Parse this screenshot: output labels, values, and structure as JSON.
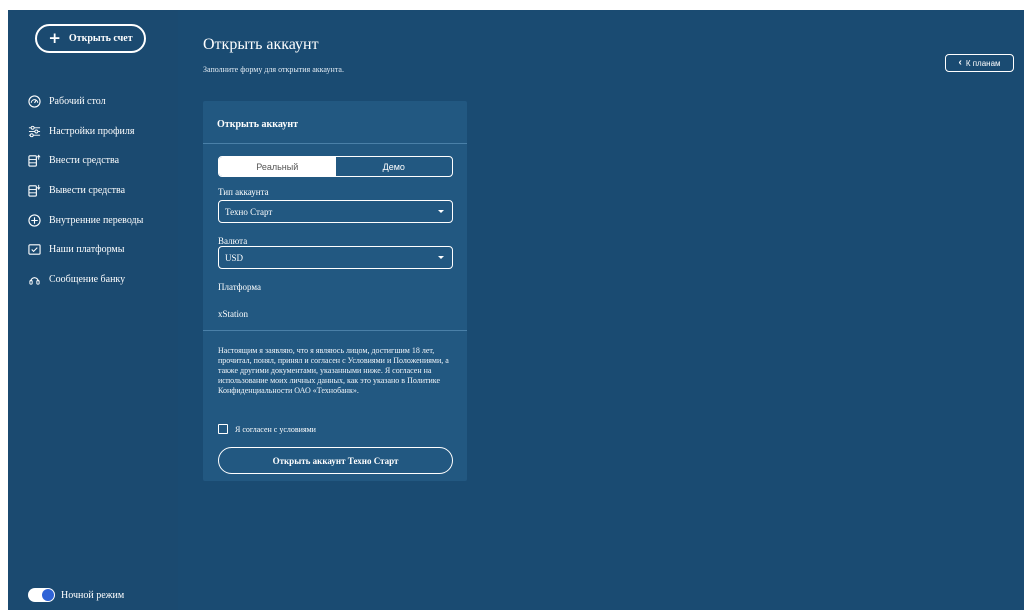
{
  "sidebar": {
    "open_account_label": "Открыть счет",
    "items": [
      {
        "icon": "speedometer-icon",
        "label": "Рабочий стол"
      },
      {
        "icon": "sliders-icon",
        "label": "Настройки профиля"
      },
      {
        "icon": "deposit-icon",
        "label": "Внести средства"
      },
      {
        "icon": "withdraw-icon",
        "label": "Вывести средства"
      },
      {
        "icon": "transfer-icon",
        "label": "Внутренние переводы"
      },
      {
        "icon": "platform-icon",
        "label": "Наши платформы"
      },
      {
        "icon": "support-icon",
        "label": "Сообщение банку"
      }
    ],
    "night_mode_label": "Ночной режим",
    "night_mode_on": true
  },
  "header": {
    "title": "Открыть аккаунт",
    "subtitle": "Заполните форму для открытия аккаунта.",
    "back_label": "К планам"
  },
  "form": {
    "title": "Открыть аккаунт",
    "tabs": [
      "Реальный",
      "Демо"
    ],
    "active_tab": "Реальный",
    "account_type_label": "Тип аккаунта",
    "account_type_value": "Техно Старт",
    "currency_label": "Валюта",
    "currency_value": "USD",
    "platform_label": "Платформа",
    "platform_value": "xStation",
    "disclaimer": "Настоящим я заявляю, что я являюсь лицом, достигшим 18 лет, прочитал, понял, принял и согласен с Условиями и Положениями, а также другими документами, указанными ниже. Я согласен на использование моих личных данных, как это указано в Политике Конфиденциальности ОАО «Технобанк».",
    "agree_label": "Я согласен с условиями",
    "agree_checked": false,
    "submit_label": "Открыть аккаунт Техно Старт"
  },
  "colors": {
    "sidebar_bg": "#1b4a70",
    "main_bg": "#1a4b72",
    "card_bg": "#225881",
    "toggle_knob": "#2f63d6"
  }
}
